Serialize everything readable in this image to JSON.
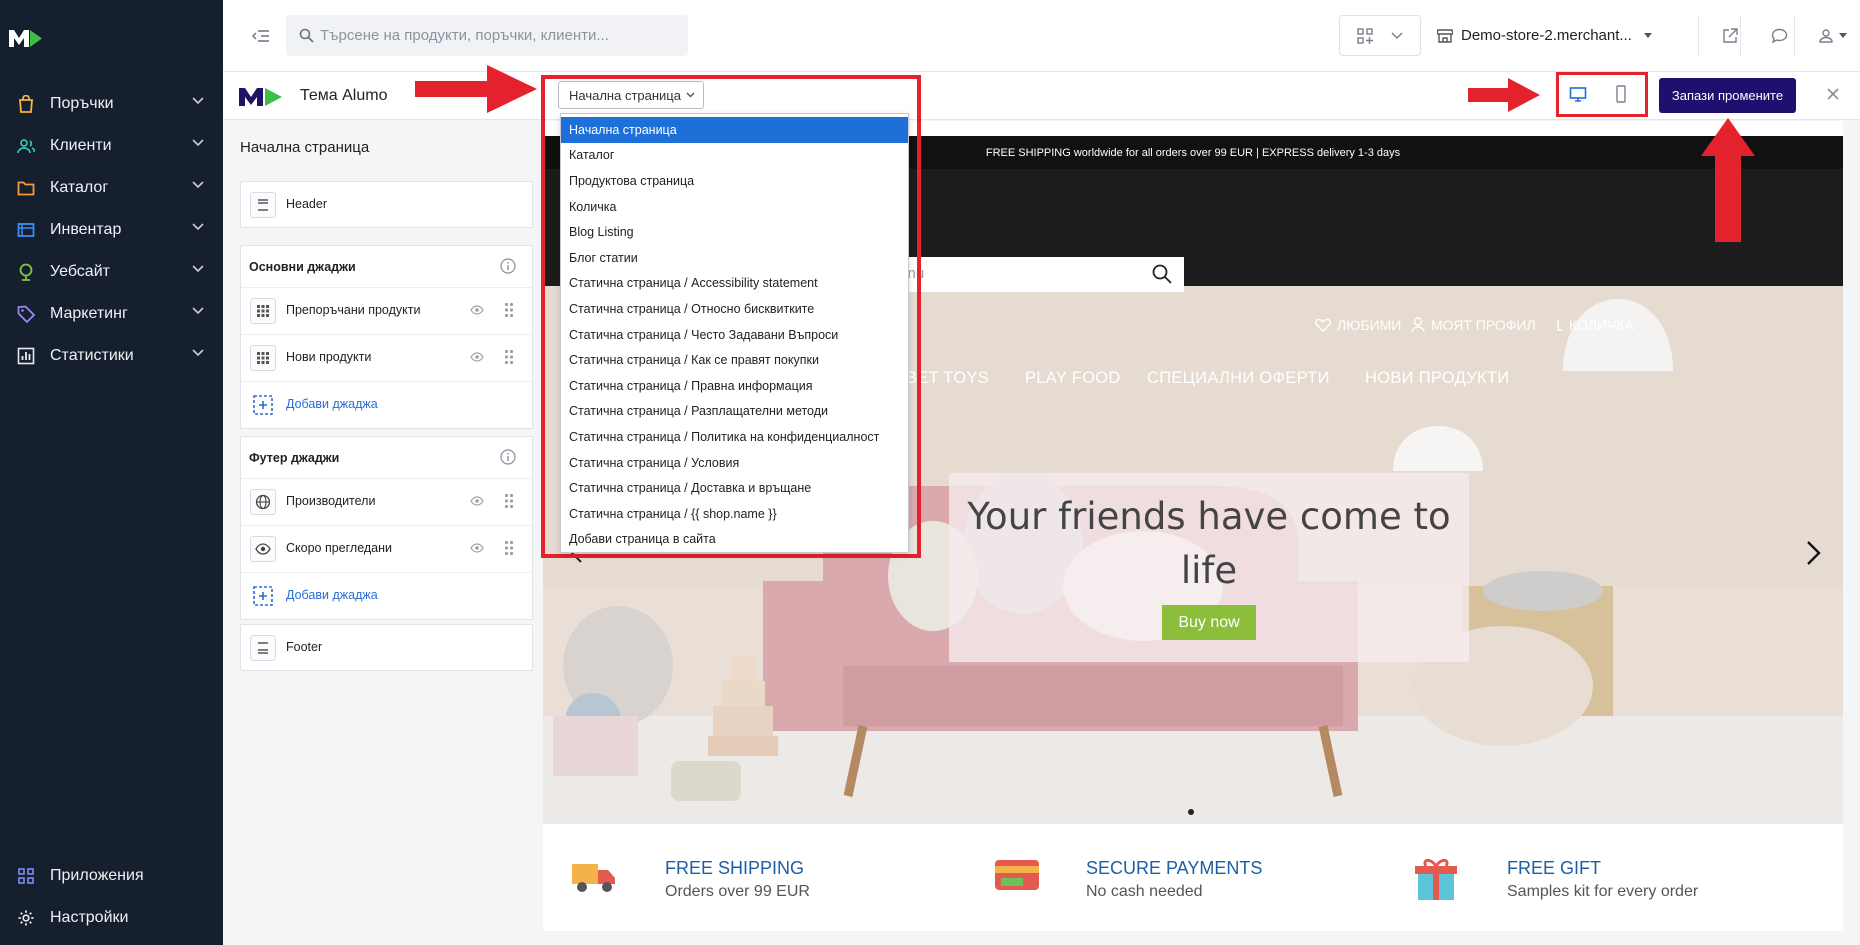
{
  "colors": {
    "nav_bg": "#161f2e",
    "accent": "#1f0f6e",
    "link": "#2b6cd8",
    "annotation_red": "#e3222e",
    "selected_option": "#1e6fd8",
    "buy_now": "#8bbf3b"
  },
  "nav": {
    "items": [
      {
        "label": "Поръчки",
        "icon": "shopping-bag-icon",
        "icon_color": "#f4b63f"
      },
      {
        "label": "Клиенти",
        "icon": "users-icon",
        "icon_color": "#34c3b4"
      },
      {
        "label": "Каталог",
        "icon": "folder-icon",
        "icon_color": "#f59a3c"
      },
      {
        "label": "Инвентар",
        "icon": "inventory-icon",
        "icon_color": "#3b8ef0"
      },
      {
        "label": "Уебсайт",
        "icon": "globe-icon",
        "icon_color": "#7cc84a"
      },
      {
        "label": "Маркетинг",
        "icon": "tag-icon",
        "icon_color": "#9a8cf2"
      },
      {
        "label": "Статистики",
        "icon": "chart-icon",
        "icon_color": "#e8eaf0"
      }
    ],
    "bottom": [
      {
        "label": "Приложения",
        "icon": "apps-icon"
      },
      {
        "label": "Настройки",
        "icon": "gear-icon"
      }
    ]
  },
  "topbar": {
    "search_placeholder": "Търсене на продукти, поръчки, клиенти...",
    "store_name": "Demo-store-2.merchant..."
  },
  "themebar": {
    "theme_name": "Тема Alumo",
    "page_select_value": "Начална страница",
    "save_label": "Запази промените"
  },
  "panel": {
    "title": "Начална страница",
    "header_label": "Header",
    "main_widgets_title": "Основни джаджи",
    "main_widgets": [
      {
        "label": "Препоръчани продукти",
        "icon": "grid-icon"
      },
      {
        "label": "Нови продукти",
        "icon": "grid-icon"
      }
    ],
    "add_widget_label": "Добави джаджа",
    "footer_widgets_title": "Футер джаджи",
    "footer_widgets": [
      {
        "label": "Производители",
        "icon": "globe-icon"
      },
      {
        "label": "Скоро прегледани",
        "icon": "eye-icon"
      }
    ],
    "add_footer_widget_label": "Добави джаджа",
    "footer_label": "Footer"
  },
  "dropdown": {
    "options": [
      "Начална страница",
      "Каталог",
      "Продуктова страница",
      "Количка",
      "Blog Listing",
      "Блог статии",
      "Статична страница / Accessibility statement",
      "Статична страница / Относно бисквитките",
      "Статична страница / Често Задавани Въпроси",
      "Статична страница / Как се правят покупки",
      "Статична страница / Правна информация",
      "Статична страница / Разплащателни методи",
      "Статична страница / Политика на конфиденциалност",
      "Статична страница / Условия",
      "Статична страница / Доставка и връщане",
      "Статична страница / {{ shop.name }}",
      "Добави страница в сайта"
    ],
    "selected_index": 0
  },
  "preview": {
    "promo": "FREE SHIPPING worldwide for all orders over 99 EUR | EXPRESS delivery 1-3 days",
    "search_fragment": "xnu",
    "favorites": "ЛЮБИМИ",
    "profile": "МОЯТ ПРОФИЛ",
    "cart": "КОЛИЧКА",
    "menu": [
      "BET TOYS",
      "PLAY FOOD",
      "СПЕЦИАЛНИ ОФЕРТИ",
      "НОВИ ПРОДУКТИ"
    ],
    "hero_title": "Your friends have come to life",
    "hero_button": "Buy now",
    "features": [
      {
        "title": "FREE SHIPPING",
        "subtitle": "Orders over 99 EUR",
        "icon": "truck-icon"
      },
      {
        "title": "SECURE PAYMENTS",
        "subtitle": "No cash needed",
        "icon": "card-icon"
      },
      {
        "title": "FREE GIFT",
        "subtitle": "Samples kit for every order",
        "icon": "gift-icon"
      }
    ]
  }
}
